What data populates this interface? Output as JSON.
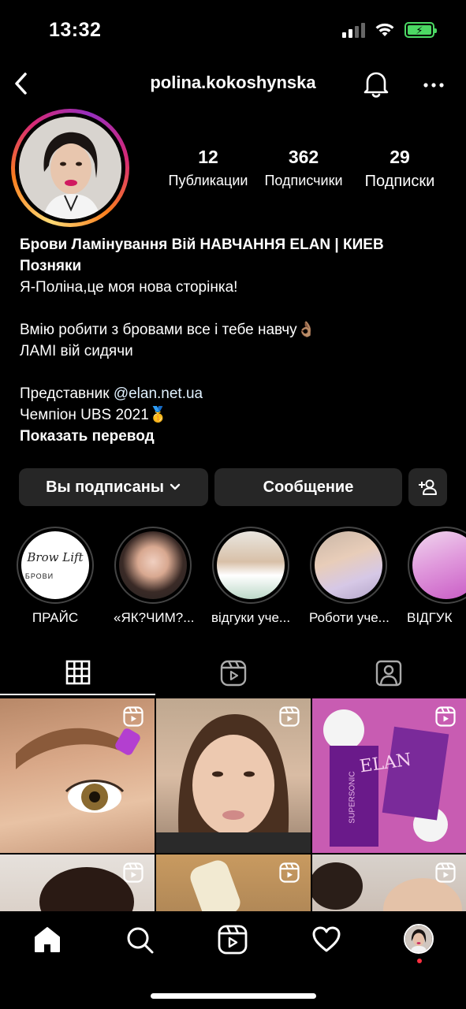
{
  "status_bar": {
    "time": "13:32"
  },
  "header": {
    "username": "polina.kokoshynska"
  },
  "stats": [
    {
      "value": "12",
      "label": "Публикации"
    },
    {
      "value": "362",
      "label": "Подписчики"
    },
    {
      "value": "29",
      "label": "Подписки"
    }
  ],
  "bio": {
    "name_line1": "Брови Ламінування Вій НАВЧАННЯ ELAN | КИЕВ",
    "name_line2": "Позняки",
    "line1": "Я-Поліна,це моя нова сторінка!",
    "line2": "Вмію робити з бровами все і тебе навчу",
    "line2_emoji": "👌🏽",
    "line3": "ЛАМІ вій сидячи",
    "line4_prefix": "Представник ",
    "line4_mention": "@elan.net.ua",
    "line5": "Чемпіон UBS 2021",
    "line5_emoji": "🥇",
    "translate": "Показать перевод"
  },
  "buttons": {
    "following": "Вы подписаны",
    "message": "Сообщение"
  },
  "highlights": [
    {
      "label": "ПРАЙС",
      "logo_text": "Brow Lift",
      "logo_sub": "БРОВИ"
    },
    {
      "label": "«ЯК?ЧИМ?..."
    },
    {
      "label": "відгуки уче..."
    },
    {
      "label": "Роботи уче..."
    },
    {
      "label": "ВІДГУК"
    }
  ],
  "tabs": [
    "grid-icon",
    "reels-icon",
    "tagged-icon"
  ],
  "grid_posts": [
    {
      "type": "reel",
      "alt_icon": "reel-icon"
    },
    {
      "type": "reel",
      "alt_icon": "reel-icon"
    },
    {
      "type": "reel",
      "alt_icon": "reel-icon",
      "brand_text": "ELAN",
      "product_text": "SUPERSONIC"
    },
    {
      "type": "reel",
      "alt_icon": "reel-icon"
    },
    {
      "type": "reel",
      "alt_icon": "reel-icon"
    },
    {
      "type": "reel",
      "alt_icon": "reel-icon"
    }
  ],
  "nav": [
    "home-icon",
    "search-icon",
    "reels-icon",
    "heart-icon",
    "profile-avatar"
  ],
  "colors": {
    "background": "#000000",
    "button_bg": "#262626",
    "mention": "#e0f1ff",
    "battery": "#4cd964"
  }
}
